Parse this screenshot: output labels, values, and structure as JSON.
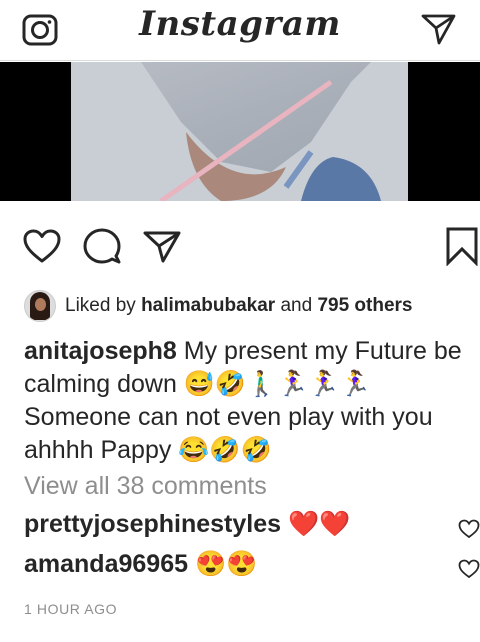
{
  "app": {
    "title": "Instagram"
  },
  "post": {
    "liked_by_prefix": "Liked by",
    "liked_by_user": "halimabubakar",
    "liked_by_and": "and",
    "liked_by_count": "795 others",
    "caption_user": "anitajoseph8",
    "caption_text": "My present my Future be calming down 😅🤣🚶‍♂️🏃‍♀️🏃‍♀️🏃‍♀️ Someone can not even play with you ahhhh Pappy 😂🤣🤣",
    "view_all_comments": "View all 38 comments",
    "comments": [
      {
        "user": "prettyjosephinestyles",
        "text": "❤️❤️"
      },
      {
        "user": "amanda96965",
        "text": "😍😍"
      }
    ],
    "timestamp": "1 HOUR AGO"
  },
  "icons": {
    "camera": "camera-icon",
    "direct": "direct-message-icon",
    "like": "heart-icon",
    "comment": "comment-icon",
    "share": "share-icon",
    "save": "bookmark-icon"
  },
  "colors": {
    "like_heart": "#ed4956",
    "muted": "#8e8e8e",
    "text": "#262626"
  }
}
